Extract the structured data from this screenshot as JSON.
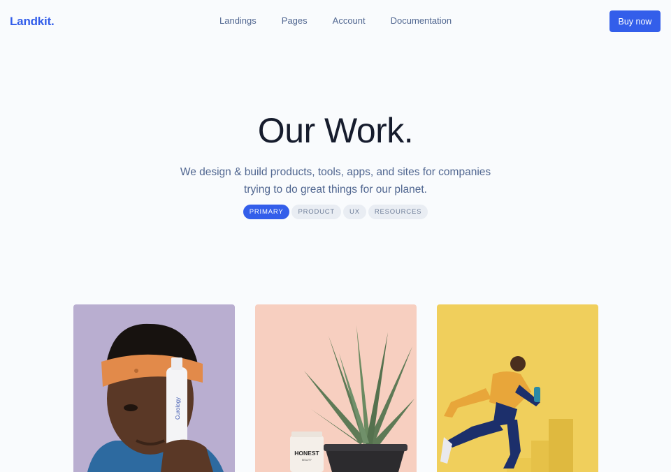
{
  "nav": {
    "brand": "Landkit.",
    "links": [
      "Landings",
      "Pages",
      "Account",
      "Documentation"
    ],
    "cta": "Buy now"
  },
  "hero": {
    "title": "Our Work.",
    "subtitle_line1": "We design & build products, tools, apps, and sites for companies",
    "subtitle_line2": "trying to do great things for our planet.",
    "filters": [
      "PRIMARY",
      "PRODUCT",
      "UX",
      "RESOURCES"
    ],
    "active_filter": "PRIMARY"
  },
  "cards": [
    {
      "bottle_label": "Curology",
      "bg": "#b9aed0"
    },
    {
      "jar_label": "HONEST",
      "jar_sub": "BEAUTY",
      "bg": "#f7cfc0"
    },
    {
      "bg": "#f0cf5c"
    }
  ],
  "colors": {
    "primary": "#335eea",
    "text": "#161c2d",
    "muted": "#506690"
  }
}
